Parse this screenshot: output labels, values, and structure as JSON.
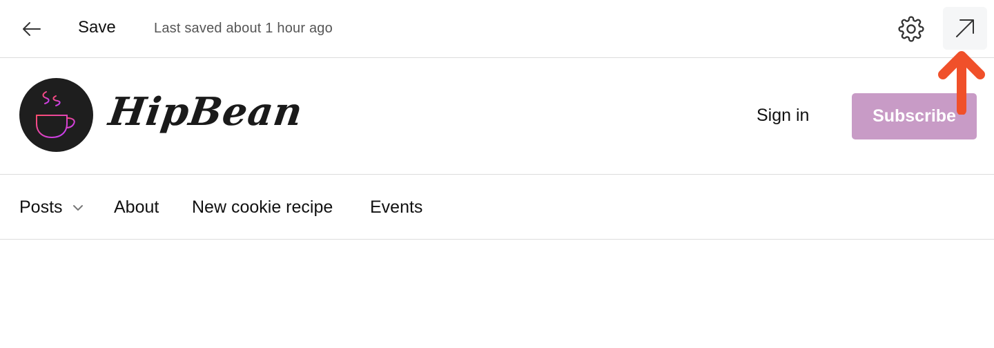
{
  "toolbar": {
    "back_icon": "arrow-left-icon",
    "save_label": "Save",
    "last_saved": "Last saved about 1 hour ago",
    "settings_icon": "gear-icon",
    "external_icon": "arrow-up-right-icon"
  },
  "site": {
    "logo_icon": "coffee-cup-icon",
    "name": "HipBean",
    "sign_in": "Sign in",
    "subscribe": "Subscribe",
    "colors": {
      "subscribe_bg": "#c89bc6",
      "logo_bg": "#1e1e1e",
      "logo_gradient_start": "#ff4d6d",
      "logo_gradient_end": "#c13cff"
    }
  },
  "nav": {
    "items": [
      {
        "label": "Posts",
        "has_dropdown": true
      },
      {
        "label": "About"
      },
      {
        "label": "New cookie recipe"
      },
      {
        "label": "Events"
      }
    ]
  },
  "annotation": {
    "icon": "arrow-up-annotation",
    "color": "#f0502a"
  }
}
